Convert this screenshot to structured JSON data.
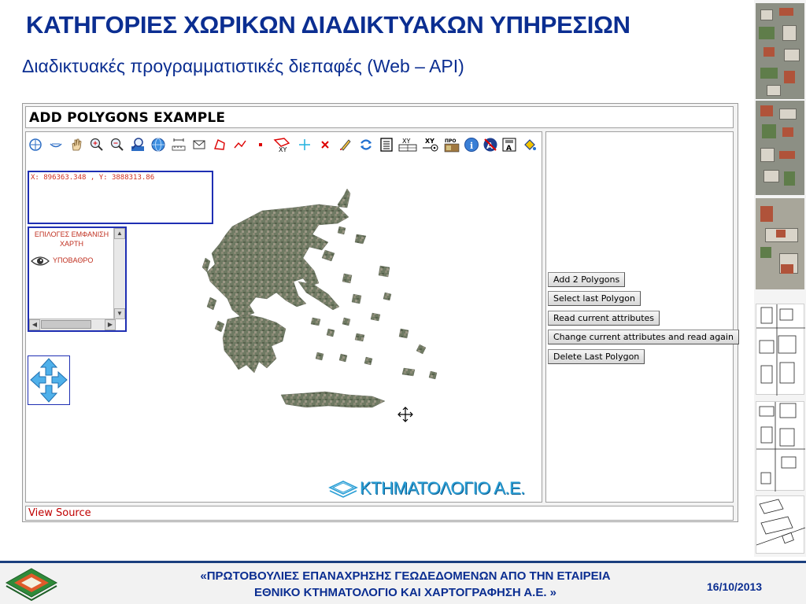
{
  "slide": {
    "title": "ΚΑΤΗΓΟΡΙΕΣ ΧΩΡΙΚΩΝ ΔΙΑΔΙΚΤΥΑΚΩΝ ΥΠΗΡΕΣΙΩΝ",
    "subtitle": "Διαδικτυακές προγραμματιστικές διεπαφές (Web – API)"
  },
  "app": {
    "header": "ADD POLYGONS EXAMPLE",
    "coords": "X: 896363.348 , Y: 3888313.86",
    "layers": {
      "title_line1": "ΕΠΙΛΟΓΕΣ ΕΜΦΑΝΙΣΗ",
      "title_line2": "ΧΑΡΤΗ",
      "items": [
        {
          "label": "ΥΠΟΒΑΘΡΟ",
          "icon": "eye-icon"
        }
      ]
    },
    "logo_text": "ΚΤΗΜΑΤΟΛΟΓΙΟ Α.Ε.",
    "buttons": [
      "Add 2 Polygons",
      "Select last Polygon",
      "Read current attributes",
      "Change current attributes and read again",
      "Delete Last Polygon"
    ],
    "footer_link": "View Source",
    "toolbar": [
      "select-point-icon",
      "zoom-out-extent-icon",
      "pan-hand-icon",
      "zoom-in-icon",
      "zoom-out-icon",
      "zoom-window-icon",
      "globe-icon",
      "measure-icon",
      "envelope-icon",
      "polygon-icon",
      "polyline-icon",
      "point-icon",
      "draw-xy-polygon-icon",
      "add-point-icon",
      "delete-icon",
      "edit-pencil-icon",
      "refresh-icon",
      "properties-icon",
      "xy-table-icon",
      "go-to-xy-icon",
      "projection-icon",
      "info-icon",
      "label-icon",
      "text-label-icon",
      "fill-icon"
    ],
    "toolbar_text": {
      "xy": "XY",
      "pro": "ΠΡΟ",
      "a": "A"
    }
  },
  "footer": {
    "line1": "«ΠΡΩΤΟΒΟΥΛΙΕΣ ΕΠΑΝΑΧΡΗΣΗΣ ΓΕΩΔΕΔΟΜΕΝΩΝ ΑΠΟ ΤΗΝ ΕΤΑΙΡΕΙΑ",
    "line2": "ΕΘΝΙΚΟ ΚΤΗΜΑΤΟΛΟΓΙΟ ΚΑΙ ΧΑΡΤΟΓΡΑΦΗΣΗ Α.Ε. »",
    "date": "16/10/2013"
  },
  "colors": {
    "title": "#0b2e91",
    "accent": "#1f2fb3",
    "label": "#c03020",
    "logo": "#2b9fd6"
  }
}
